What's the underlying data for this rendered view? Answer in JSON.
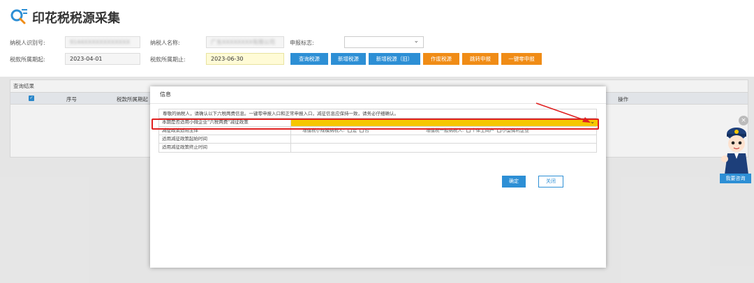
{
  "header": {
    "title": "印花税税源采集"
  },
  "form": {
    "taxpayer_id_label": "纳税人识别号:",
    "taxpayer_id_value": "9144XXXXXXXXXXXX",
    "taxpayer_name_label": "纳税人名称:",
    "taxpayer_name_value": "广东XXXXXXXX有限公司",
    "declare_flag_label": "申报标志:",
    "period_start_label": "税款所属期起:",
    "period_start_value": "2023-04-01",
    "period_end_label": "税款所属期止:",
    "period_end_value": "2023-06-30",
    "buttons": [
      "查询税源",
      "新增税源",
      "新增税源（旧）",
      "作废税源",
      "跳转申报",
      "一键零申报"
    ]
  },
  "results": {
    "title": "查询结果",
    "columns": [
      "序号",
      "税款所属期起",
      "操作"
    ]
  },
  "modal": {
    "title": "信息",
    "notice": "尊敬的纳税人，请确认以下六税两费信息。一键零申报入口和正常申报入口，减征信息应保持一致，请务必仔细确认。",
    "rows": [
      {
        "label": "本期是否适用小微企业“六税两费”减征政策"
      },
      {
        "label": "减征政策适用主体"
      },
      {
        "label": "适用减征政策起始时间"
      },
      {
        "label": "适用减征政策终止时间"
      }
    ],
    "small_taxpayer_label": "增值税小规模纳税人:",
    "opt_yes": "是",
    "opt_no": "否",
    "general_taxpayer_label": "增值税一般纳税人:",
    "opt_individual": "个体工商户",
    "opt_small_micro": "小型微利企业",
    "ok_label": "确定",
    "close_label": "关闭"
  },
  "mascot": {
    "consult_label": "我要咨询"
  },
  "colors": {
    "primary": "#2d8fd5",
    "orange": "#f08c16",
    "highlight": "#f6c700",
    "annotation": "#e02020"
  }
}
